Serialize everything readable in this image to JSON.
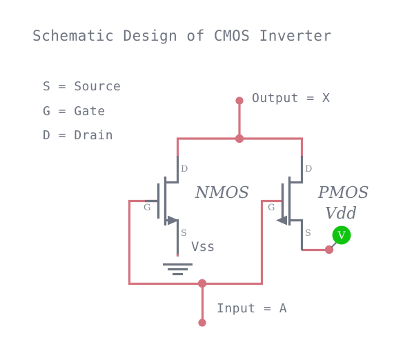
{
  "title": "Schematic Design of CMOS Inverter",
  "legend": {
    "items": [
      "S = Source",
      "G = Gate",
      "D = Drain"
    ]
  },
  "labels": {
    "output": "Output = X",
    "input": "Input = A",
    "nmos": "NMOS",
    "pmos": "PMOS",
    "vss": "Vss",
    "vdd": "Vdd",
    "voltage_source": "V"
  },
  "pins": {
    "nmos_drain": "D",
    "nmos_gate": "G",
    "nmos_source": "S",
    "pmos_drain": "D",
    "pmos_gate": "G",
    "pmos_source": "S"
  },
  "colors": {
    "wire": "#d4737f",
    "device": "#6e7480",
    "pin_label": "#8b9098",
    "voltage_source": "#10c410",
    "background": "#ffffff",
    "text": "#6e7480"
  }
}
